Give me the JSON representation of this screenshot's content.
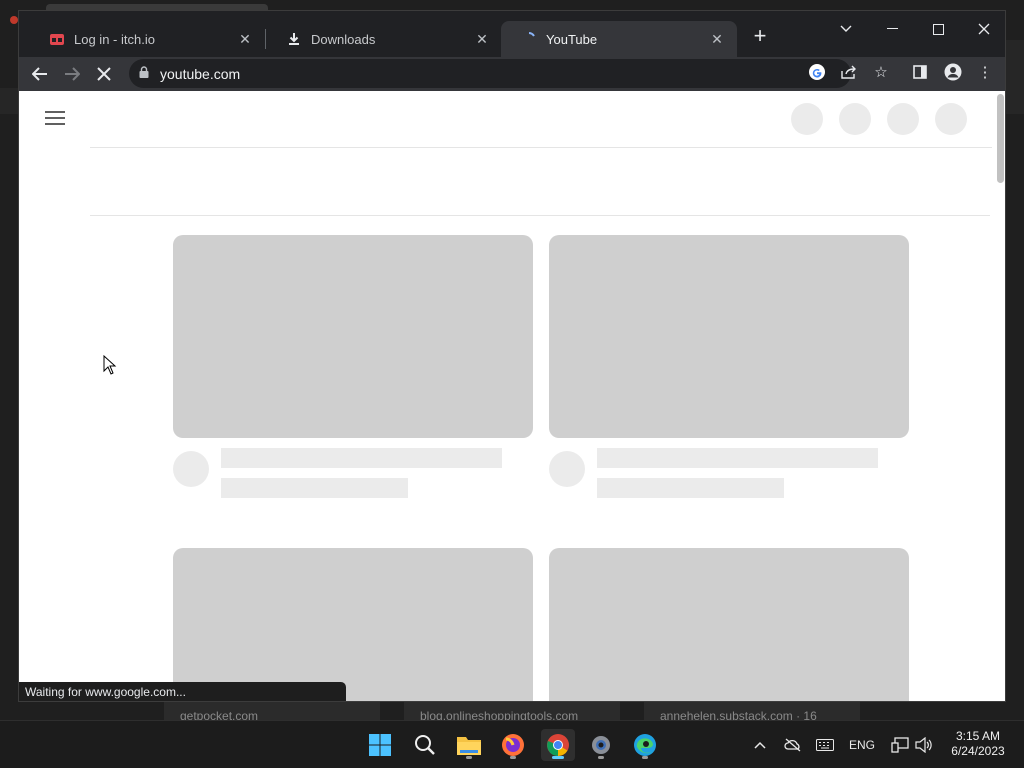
{
  "browser": {
    "tabs": [
      {
        "title": "Log in - itch.io",
        "favicon": "itch-io-icon",
        "active": false
      },
      {
        "title": "Downloads",
        "favicon": "download-icon",
        "active": false
      },
      {
        "title": "YouTube",
        "favicon": "loading-spinner-icon",
        "active": true
      }
    ],
    "new_tab_label": "+",
    "address": "youtube.com",
    "status_text": "Waiting for www.google.com..."
  },
  "background_windows": [
    "getpocket.com",
    "blog.onlineshoppingtools.com",
    "annehelen.substack.com · 16"
  ],
  "taskbar": {
    "apps": [
      "start-icon",
      "search-icon",
      "file-explorer-icon",
      "firefox-icon",
      "chrome-icon",
      "settings-icon",
      "edge-icon"
    ],
    "language": "ENG",
    "time": "3:15 AM",
    "date": "6/24/2023"
  },
  "colors": {
    "tab_bar": "#202124",
    "toolbar": "#35363a",
    "skeleton_thumb": "#cfcfcf",
    "skeleton_line": "#ebebeb"
  }
}
